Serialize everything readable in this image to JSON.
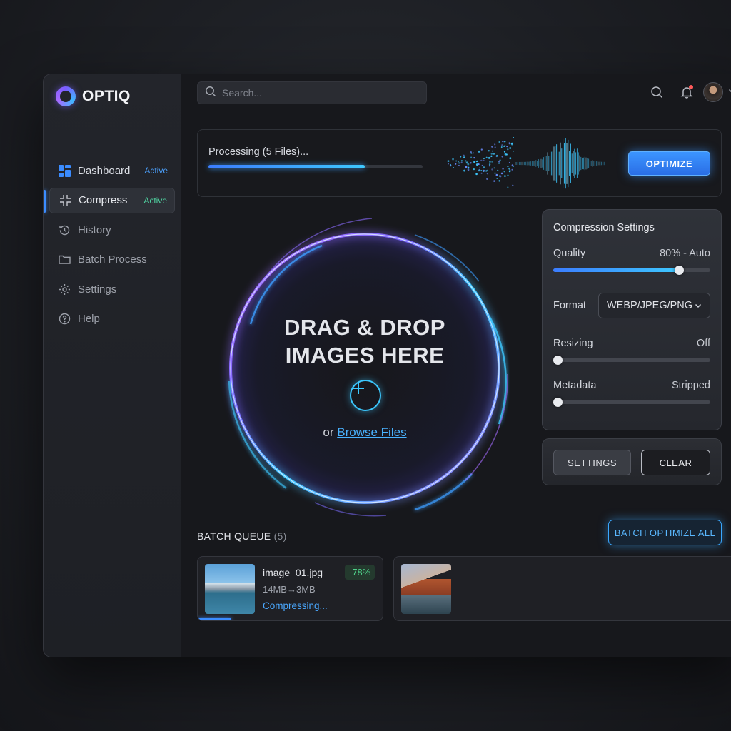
{
  "app": {
    "name": "OPTIQ"
  },
  "sidebar": {
    "items": [
      {
        "label": "Dashboard",
        "badge": "Active",
        "icon": "dashboard-icon"
      },
      {
        "label": "Compress",
        "badge": "Active",
        "icon": "compress-icon"
      },
      {
        "label": "History",
        "badge": "",
        "icon": "history-icon"
      },
      {
        "label": "Batch Process",
        "badge": "",
        "icon": "folder-icon"
      },
      {
        "label": "Settings",
        "badge": "",
        "icon": "gear-icon"
      },
      {
        "label": "Help",
        "badge": "",
        "icon": "help-icon"
      }
    ]
  },
  "search": {
    "placeholder": "Search..."
  },
  "processing": {
    "title": "Processing (5 Files)...",
    "progress": 0.73,
    "button": "OPTIMIZE"
  },
  "dropzone": {
    "title_line1": "DRAG & DROP",
    "title_line2": "IMAGES HERE",
    "prefix": "or",
    "link": "Browse Files"
  },
  "compression": {
    "title": "Compression Settings",
    "quality_label": "Quality",
    "quality_value": "80% - Auto",
    "quality_level": 0.8,
    "format_label": "Format",
    "format_value": "WEBP/JPEG/PNG",
    "resizing_label": "Resizing",
    "resizing_value": "Off",
    "metadata_label": "Metadata",
    "metadata_value": "Stripped"
  },
  "actions": {
    "settings": "SETTINGS",
    "clear": "CLEAR"
  },
  "batch": {
    "title": "BATCH QUEUE",
    "count": "(5)",
    "button": "BATCH OPTIMIZE ALL",
    "items": [
      {
        "name": "image_01.jpg",
        "size": "14MB→3MB",
        "status": "Compressing...",
        "reduction": "-78%",
        "progress": 0.18
      }
    ]
  },
  "colors": {
    "accent": "#3b8cff",
    "success": "#4fd18a",
    "neon_cyan": "#3cc8ff",
    "neon_purple": "#a46bff"
  }
}
